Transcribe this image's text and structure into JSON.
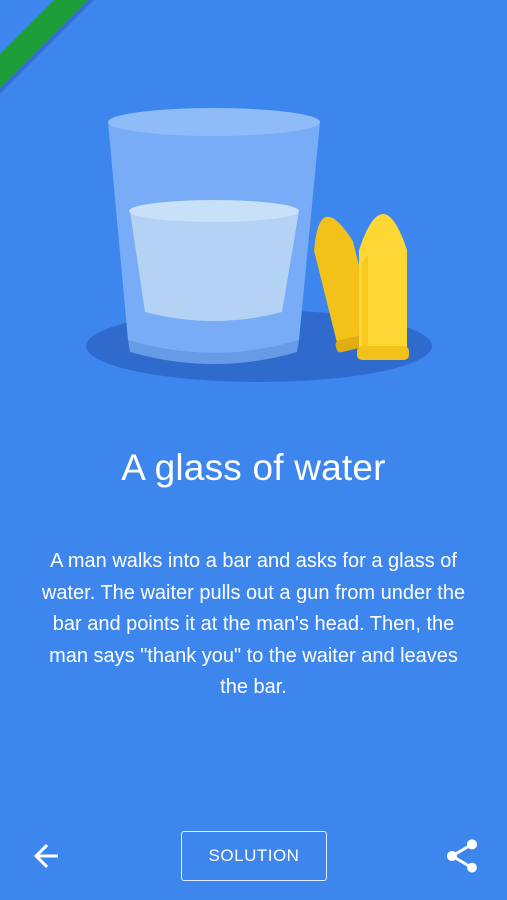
{
  "riddle": {
    "title": "A glass of water",
    "description": "A man walks into a bar and asks for a glass of water. The waiter pulls out a gun from under the bar and points it at the man's head. Then, the man says \"thank you\" to the waiter and leaves the bar."
  },
  "footer": {
    "back_icon": "arrow-back-icon",
    "solution_label": "SOLUTION",
    "share_icon": "share-icon"
  },
  "colors": {
    "background": "#3d86ee",
    "ribbon": "#1e9e3a",
    "glass": "#7fb2f7",
    "water": "#b8d5f3",
    "shadow": "#2f6bcd",
    "bullet": "#fdd835"
  }
}
